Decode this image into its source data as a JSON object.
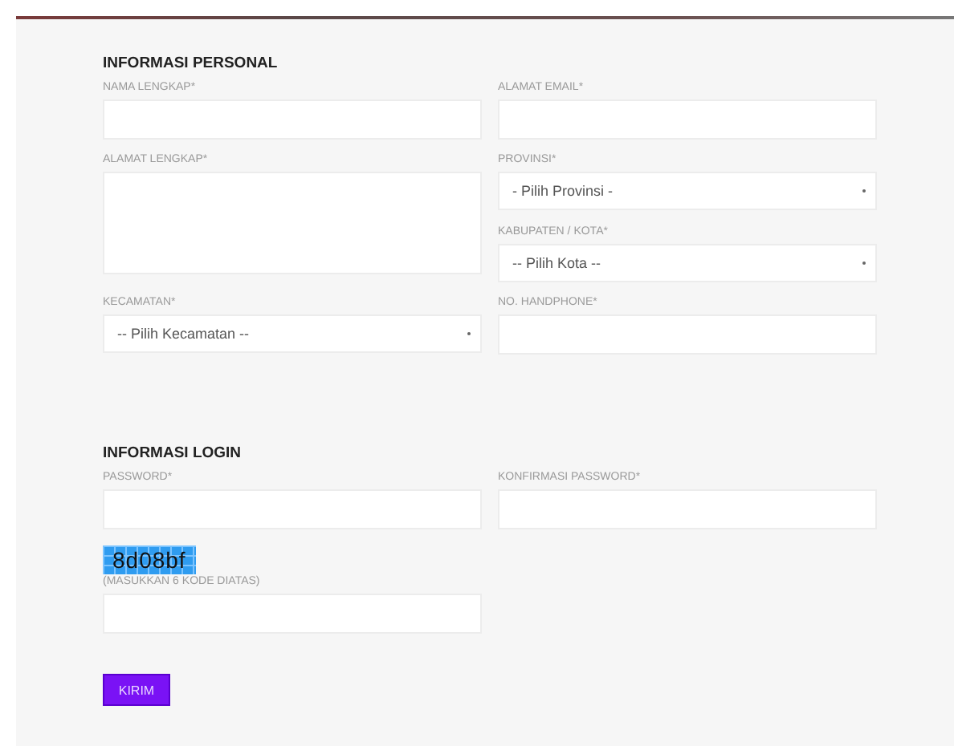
{
  "personal": {
    "title": "INFORMASI PERSONAL",
    "rows": [
      {
        "left": [
          {
            "kind": "text",
            "label": "NAMA LENGKAP*"
          }
        ],
        "right": [
          {
            "kind": "text",
            "label": "ALAMAT EMAIL*"
          }
        ]
      },
      {
        "left": [
          {
            "kind": "textarea",
            "label": "ALAMAT LENGKAP*"
          }
        ],
        "right": [
          {
            "kind": "select",
            "label": "PROVINSI*",
            "value": "- Pilih Provinsi -"
          },
          {
            "kind": "select",
            "label": "KABUPATEN / KOTA*",
            "value": "-- Pilih Kota --"
          }
        ]
      },
      {
        "left": [
          {
            "kind": "select",
            "label": "KECAMATAN*",
            "value": "-- Pilih Kecamatan --"
          }
        ],
        "right": [
          {
            "kind": "text",
            "label": "NO. HANDPHONE*"
          }
        ]
      }
    ]
  },
  "login": {
    "title": "INFORMASI LOGIN",
    "rows": [
      {
        "left": [
          {
            "kind": "text",
            "label": "PASSWORD*"
          }
        ],
        "right": [
          {
            "kind": "text",
            "label": "KONFIRMASI PASSWORD*"
          }
        ]
      }
    ]
  },
  "captcha": {
    "code": "8d08bf",
    "label": "(MASUKKAN 6 KODE DIATAS)"
  },
  "submit": "KIRIM"
}
